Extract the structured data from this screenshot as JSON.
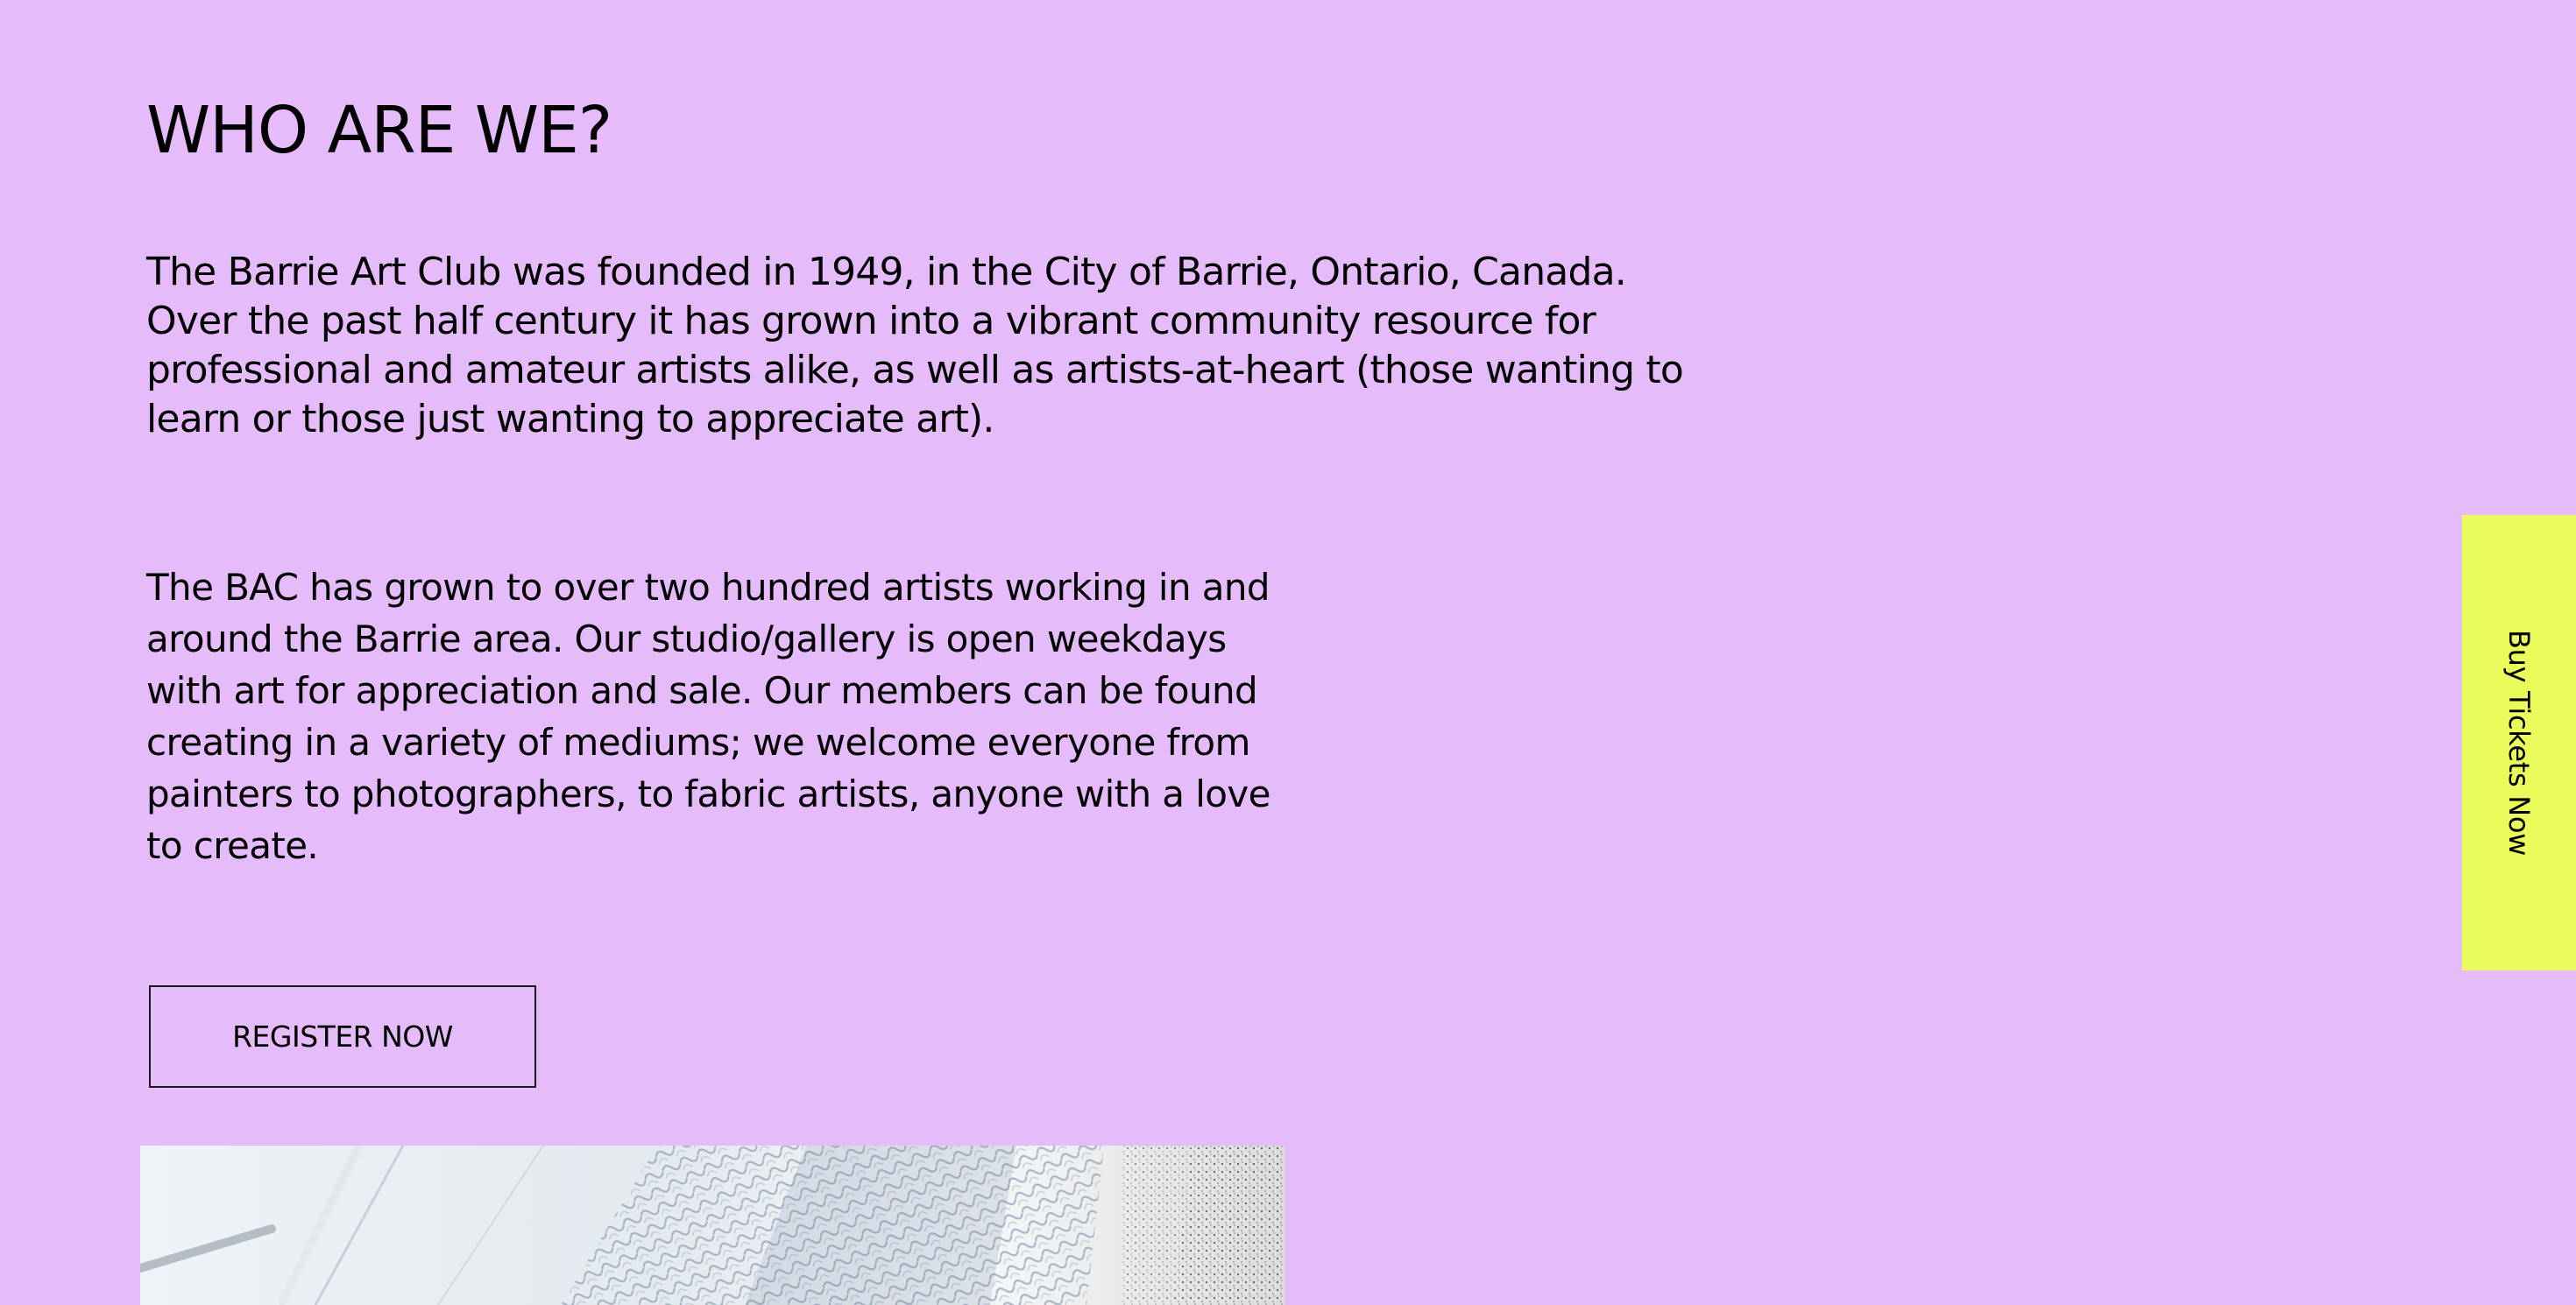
{
  "section": {
    "title": "WHO ARE WE?",
    "paragraph_1": "The Barrie Art Club was founded in 1949, in the City of Barrie, Ontario, Canada. Over the past half century it has grown into a vibrant community resource for professional and amateur artists alike, as well as artists-at-heart (those wanting to learn or those just wanting to appreciate art).",
    "paragraph_2": "The BAC has grown to over two hundred artists working in and around the Barrie area. Our studio/gallery is open weekdays with art for appreciation and sale.  Our members can be found creating in a variety of mediums; we welcome everyone from painters to photographers, to fabric artists, anyone with a love to create.",
    "register_label": "REGISTER NOW"
  },
  "side_tab": {
    "label": "Buy Tickets Now"
  },
  "colors": {
    "background": "#e6bbf9",
    "tab_background": "#eafc5b",
    "text": "#000000"
  }
}
